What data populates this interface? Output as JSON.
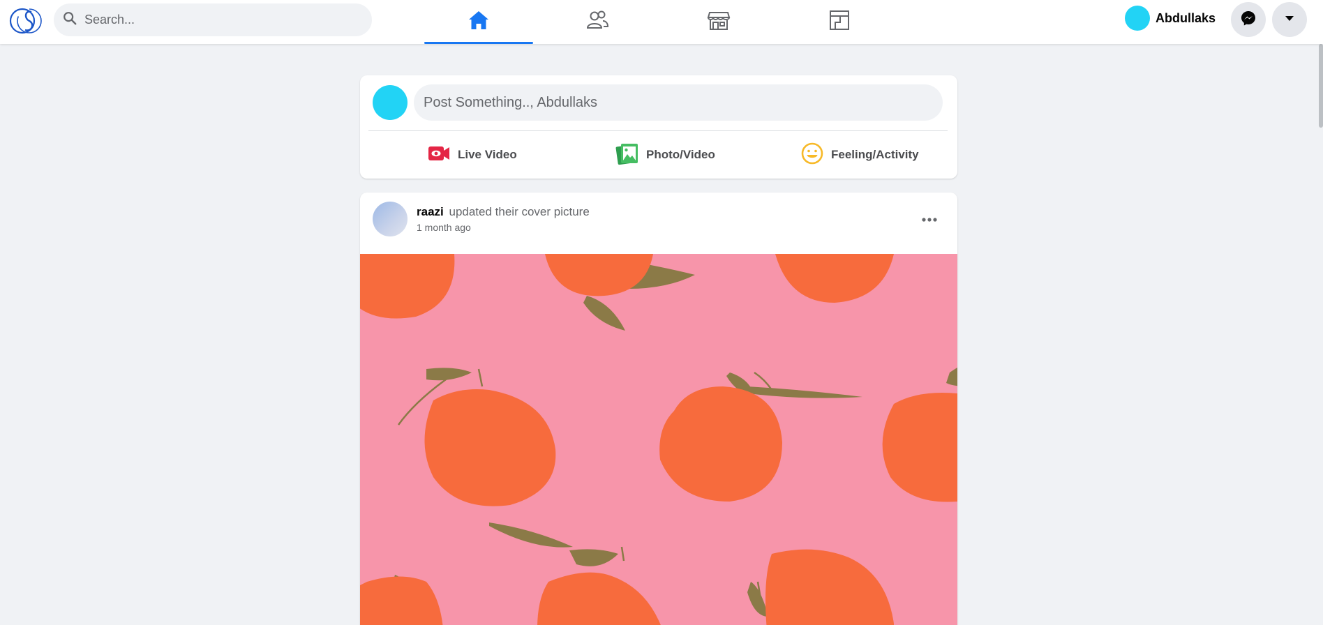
{
  "header": {
    "logo_icon": "cs-monogram-logo",
    "search": {
      "placeholder": "Search...",
      "value": ""
    },
    "nav_tabs": [
      {
        "name": "home",
        "icon": "home-icon",
        "active": true
      },
      {
        "name": "friends",
        "icon": "friends-icon",
        "active": false
      },
      {
        "name": "marketplace",
        "icon": "store-icon",
        "active": false
      },
      {
        "name": "groups",
        "icon": "layout-icon",
        "active": false
      }
    ],
    "profile_name": "Abdullaks",
    "messenger_icon": "messenger-icon",
    "menu_icon": "caret-down-icon"
  },
  "composer": {
    "placeholder": "Post Something.., Abdullaks",
    "actions": [
      {
        "label": "Live Video",
        "icon": "video-camera-icon"
      },
      {
        "label": "Photo/Video",
        "icon": "photo-icon"
      },
      {
        "label": "Feeling/Activity",
        "icon": "smiley-icon"
      }
    ]
  },
  "post": {
    "author": "raazi",
    "action": "updated their cover picture",
    "time": "1 month ago",
    "more_icon": "more-dots-icon",
    "image_description": "cover-picture"
  },
  "colors": {
    "accent": "#1877f2",
    "avatar": "#22d3f5",
    "background": "#f0f2f5",
    "live_video": "#e42645",
    "photo": "#45bd62",
    "feeling": "#f7b928",
    "image_pink": "#f795aa",
    "orange": "#f76b3d",
    "leaf": "#8b7a47"
  }
}
